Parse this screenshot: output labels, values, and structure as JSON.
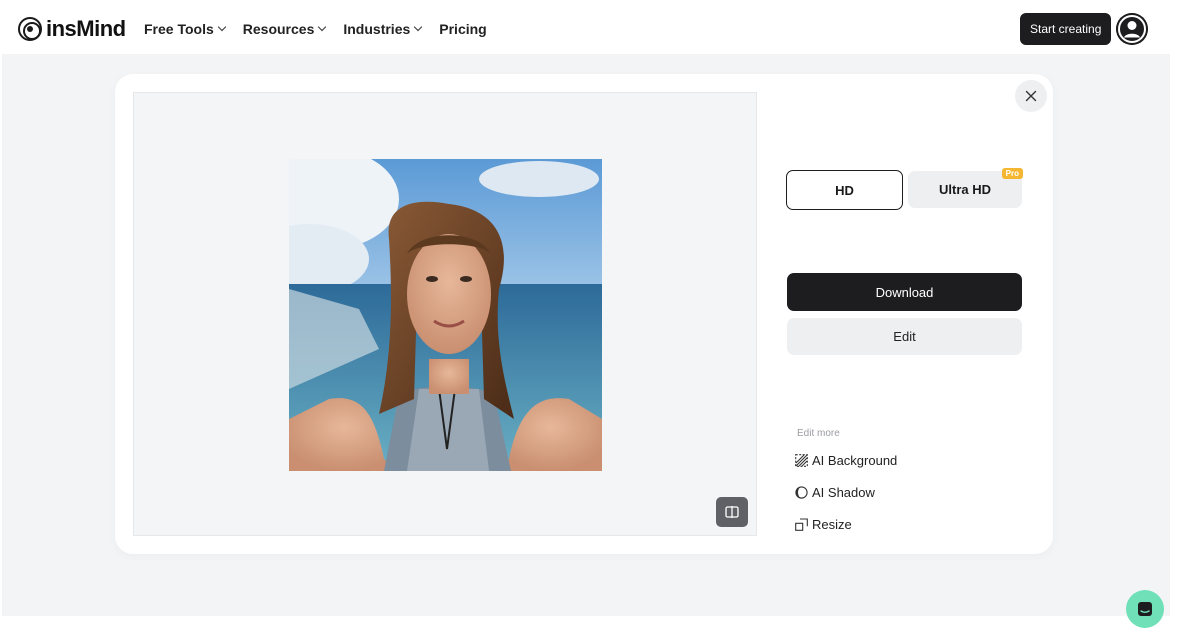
{
  "header": {
    "logo_text": "insMind",
    "nav": [
      {
        "label": "Free Tools",
        "has_dropdown": true
      },
      {
        "label": "Resources",
        "has_dropdown": true
      },
      {
        "label": "Industries",
        "has_dropdown": true
      },
      {
        "label": "Pricing",
        "has_dropdown": false
      }
    ],
    "start_button": "Start creating",
    "avatar_icon": "user-icon"
  },
  "preview": {
    "image_alt": "photo",
    "compare_icon": "compare-icon"
  },
  "panel": {
    "close_icon": "close-icon",
    "resolutions": [
      {
        "label": "HD",
        "selected": true
      },
      {
        "label": "Ultra HD",
        "selected": false,
        "badge": "Pro"
      }
    ],
    "download_label": "Download",
    "edit_label": "Edit",
    "edit_more_label": "Edit more",
    "edit_more_items": [
      {
        "label": "AI Background",
        "icon": "hatch-icon"
      },
      {
        "label": "AI Shadow",
        "icon": "shadow-icon"
      },
      {
        "label": "Resize",
        "icon": "resize-icon"
      }
    ]
  },
  "colors": {
    "primary_dark": "#1d1d1f",
    "page_bg": "#f3f4f6",
    "pro_badge": "#f5b731",
    "chat_button": "#6fe0b8"
  },
  "chat": {
    "icon": "chat-icon"
  }
}
